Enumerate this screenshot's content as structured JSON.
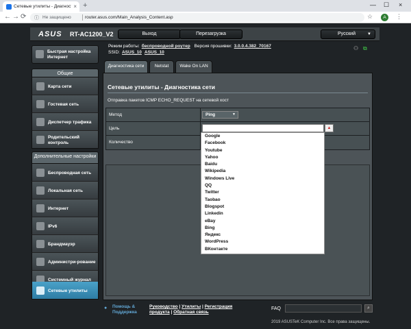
{
  "browser": {
    "tab_title": "Сетевые утилиты - Диагностика с",
    "tab_close": "×",
    "new_tab": "+",
    "win_min": "—",
    "win_max": "☐",
    "win_close": "×",
    "back": "←",
    "forward": "→",
    "reload": "⟳",
    "security_label": "Не защищено",
    "url": "router.asus.com/Main_Analysis_Content.asp",
    "avatar_letter": "A",
    "menu": "⋮",
    "star": "☆"
  },
  "header": {
    "logo": "ASUS",
    "model": "RT-AC1200_V2",
    "logout_label": "Выход",
    "reboot_label": "Перезагрузка",
    "language": "Русский"
  },
  "status": {
    "mode_label": "Режим работы:",
    "mode_value": "беспроводной роутер",
    "firmware_label": "Версия прошивки:",
    "firmware_value": "3.0.0.4.382_70167",
    "ssid_label": "SSID:",
    "ssid_1": "ASUS_10",
    "ssid_2": "ASUS_10"
  },
  "sidebar": {
    "quick_setup": "Быстрая настройка Интернет",
    "general_header": "Общие",
    "general_items": [
      {
        "label": "Карта сети"
      },
      {
        "label": "Гостевая сеть"
      },
      {
        "label": "Диспетчер трафика"
      },
      {
        "label": "Родительский контроль"
      }
    ],
    "advanced_header": "Дополнительные настройки",
    "advanced_items": [
      {
        "label": "Беспроводная сеть"
      },
      {
        "label": "Локальная сеть"
      },
      {
        "label": "Интернет"
      },
      {
        "label": "IPv6"
      },
      {
        "label": "Брандмауэр"
      },
      {
        "label": "Администри-рование"
      },
      {
        "label": "Системный журнал"
      },
      {
        "label": "Сетевые утилиты"
      }
    ]
  },
  "tabs": [
    {
      "label": "Диагностика сети"
    },
    {
      "label": "Netstat"
    },
    {
      "label": "Wake On LAN"
    }
  ],
  "main": {
    "title": "Сетевые утилиты - Диагностика сети",
    "description": "Отправка пакетов ICMP ECHO_REQUEST на сетевой хост",
    "method_label": "Метод",
    "method_value": "Ping",
    "target_label": "Цель",
    "target_placeholder": "",
    "count_label": "Количество",
    "dropdown_options": [
      "Google",
      "Facebook",
      "Youtube",
      "Yahoo",
      "Baidu",
      "Wikipedia",
      "Windows Live",
      "QQ",
      "Twitter",
      "Taobao",
      "Blogspot",
      "Linkedin",
      "eBay",
      "Bing",
      "Яндекс",
      "WordPress",
      "ВКонтакте"
    ]
  },
  "footer": {
    "help_line1": "Помощь &",
    "help_line2": "Поддержка",
    "links_line1_a": "Руководство",
    "links_line1_b": "Утилиты",
    "links_line1_c": "Регистрация",
    "links_line2_a": "продукта",
    "links_line2_b": "Обратная связь",
    "sep": " | ",
    "faq_label": "FAQ",
    "copyright": "2019 ASUSTeK Computer Inc. Все права защищены."
  }
}
